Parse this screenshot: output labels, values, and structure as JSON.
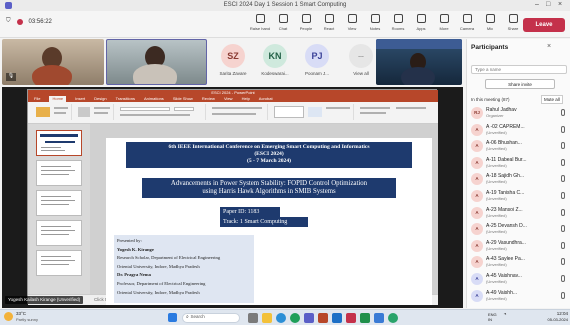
{
  "window": {
    "title": "ESCI 2024 Day 1 Session 1 Smart Computing"
  },
  "toolbar": {
    "timer": "03:56:22",
    "buttons": [
      "Raise hand",
      "Chat",
      "People",
      "React",
      "View",
      "Notes",
      "Rooms",
      "Apps",
      "More",
      "Camera",
      "Mic",
      "Share"
    ],
    "leave": "Leave"
  },
  "participants_strip": {
    "avatars": [
      {
        "initials": "SZ",
        "name": "Sarita Zavare",
        "bg": "#f6d3cf",
        "fg": "#8a3a32"
      },
      {
        "initials": "KN",
        "name": "Kodeswarai...",
        "bg": "#cfe9dd",
        "fg": "#226046"
      },
      {
        "initials": "PJ",
        "name": "Poonam J...",
        "bg": "#d8dcf6",
        "fg": "#3b4298"
      }
    ],
    "more": "View all"
  },
  "ppt": {
    "title": "ESCI 2024 - PowerPoint",
    "menu": [
      "File",
      "Home",
      "Insert",
      "Design",
      "Transitions",
      "Animations",
      "Slide Show",
      "Review",
      "View",
      "Help",
      "Acrobat"
    ],
    "active_menu": "Home",
    "notes_hint": "Click to add notes"
  },
  "slide": {
    "conf_title": "6th IEEE International Conference on Emerging Smart Computing and Informatics",
    "conf_short": "(ESCI 2024)",
    "conf_dates": "(5 - 7 March 2024)",
    "paper_title_1": "Advancements in Power System Stability: FOPID Control Optimization",
    "paper_title_2": "using Harris Hawk Algorithms in SMIB Systems",
    "paper_id": "Paper ID: 1183",
    "track": "Track: 1 Smart Computing",
    "presenter_block": [
      "Presented by:",
      "Yogesh K. Kirange",
      "Research Scholar, Department of Electrical Engineering",
      "Oriental University, Indore, Madhya Pradesh",
      "Dr. Pragya Nema",
      "Professor, Department of Electrical Engineering",
      "Oriental University, Indore, Madhya Pradesh"
    ]
  },
  "presenter_label": "Yogesh Kailash Kirange (Unverified)",
  "panel": {
    "title": "Participants",
    "search_placeholder": "Type a name",
    "share_invite": "Share invite",
    "section": "In this meeting (87)",
    "mute_all": "Mute all",
    "people": [
      {
        "initials": "RJ",
        "name": "Rahul Jadhav",
        "sub": "Organizer",
        "bg": "#f6d3cf",
        "fg": "#8a3a32"
      },
      {
        "initials": "A",
        "name": "A -02 CAPREM...",
        "sub": "(Unverified)",
        "bg": "#f6d3cf",
        "fg": "#8a3a32"
      },
      {
        "initials": "A",
        "name": "A-06 Bhushan...",
        "sub": "(Unverified)",
        "bg": "#f6d3cf",
        "fg": "#8a3a32"
      },
      {
        "initials": "A",
        "name": "A-11 Dabeal Bur...",
        "sub": "(Unverified)",
        "bg": "#f6d3cf",
        "fg": "#8a3a32"
      },
      {
        "initials": "A",
        "name": "A-18 Sajidh Gh...",
        "sub": "(Unverified)",
        "bg": "#f6d3cf",
        "fg": "#8a3a32"
      },
      {
        "initials": "A",
        "name": "A-19 Tanisha C...",
        "sub": "(Unverified)",
        "bg": "#f6d3cf",
        "fg": "#8a3a32"
      },
      {
        "initials": "A",
        "name": "A-23 Mansoi Z...",
        "sub": "(Unverified)",
        "bg": "#f6d3cf",
        "fg": "#8a3a32"
      },
      {
        "initials": "A",
        "name": "A-25 Devansh D...",
        "sub": "(Unverified)",
        "bg": "#f6d3cf",
        "fg": "#8a3a32"
      },
      {
        "initials": "A",
        "name": "A-29 Vasundhra...",
        "sub": "(Unverified)",
        "bg": "#f6d3cf",
        "fg": "#8a3a32"
      },
      {
        "initials": "A",
        "name": "A-43 Saylee Pa...",
        "sub": "(Unverified)",
        "bg": "#f6d3cf",
        "fg": "#8a3a32"
      },
      {
        "initials": "A",
        "name": "A-45 Vaishnav...",
        "sub": "(Unverified)",
        "bg": "#d8dcf6",
        "fg": "#3b4298"
      },
      {
        "initials": "A",
        "name": "A-49 Vaishh...",
        "sub": "(Unverified)",
        "bg": "#d8dcf6",
        "fg": "#3b4298"
      }
    ]
  },
  "taskbar": {
    "weather_temp": "33°C",
    "weather_desc": "Partly sunny",
    "search_label": "Search",
    "lang": "ENG\nIN",
    "time": "12:04",
    "date": "05-03-2024"
  }
}
